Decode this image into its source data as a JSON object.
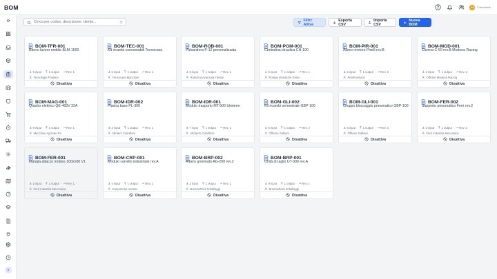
{
  "app": {
    "title": "BOM"
  },
  "header": {
    "user": {
      "initials": "AS",
      "name": "Cavia Andr..."
    }
  },
  "sidebar": {
    "avatar_initials": "T"
  },
  "search": {
    "placeholder": "Cerca per codice, descrizione, cliente..."
  },
  "toolbar": {
    "filter_label": "Filtri: Attive",
    "export_label": "Esporta CSV",
    "import_label": "Importa CSV",
    "new_label": "Nuova BOM"
  },
  "cards": [
    {
      "code": "BOM-TFR-001",
      "desc": "Banco lavoro mobile BLM-1500",
      "inputs": "5 input",
      "outputs": "1 output",
      "rev": "Rev. 1",
      "client": "Tecnologie Friulane",
      "action": "Disattiva"
    },
    {
      "code": "BOM-TEC-001",
      "desc": "Kit ricambi consumabili Tecnocasa",
      "inputs": "5 input",
      "outputs": "1 output",
      "rev": "Rev. 1",
      "client": "Tecnocasa Macchine",
      "action": "Disattiva"
    },
    {
      "code": "BOM-ROB-001",
      "desc": "Pulsantiera P-12 personalizzata",
      "inputs": "8 input",
      "outputs": "1 output",
      "rev": "Rev. 1",
      "client": "Robotica Avanzata Trieste",
      "action": "Disattiva"
    },
    {
      "code": "BOM-POM-001",
      "desc": "Centralina idraulica CH-100",
      "inputs": "9 input",
      "outputs": "1 output",
      "rev": "Rev. 1",
      "client": "Pompe Idrauliche Torino",
      "action": "Disattiva"
    },
    {
      "code": "BOM-PIR-001",
      "desc": "Albero motore Pirelli rev.B",
      "inputs": "2 input",
      "outputs": "1 output",
      "rev": "Rev. 2",
      "client": "Pirelli Service",
      "action": "Disattiva"
    },
    {
      "code": "BOM-MOD-001",
      "desc": "Carena C-50 rev.B Modena Racing",
      "inputs": "2 input",
      "outputs": "1 output",
      "rev": "Rev. 2",
      "client": "Officine Modena Racing",
      "action": "Disattiva"
    },
    {
      "code": "BOM-MAG-001",
      "desc": "Quadro elettrico QE-400V 32A",
      "inputs": "9 input",
      "outputs": "1 output",
      "rev": "Rev. 1",
      "client": "Macchine Agricole Po",
      "action": "Disattiva"
    },
    {
      "code": "BOM-IDR-002",
      "desc": "Piastra base PL-300",
      "inputs": "2 input",
      "outputs": "1 output",
      "rev": "Rev. 1",
      "client": "Idrotern Calorifero",
      "action": "Disattiva"
    },
    {
      "code": "BOM-IDR-001",
      "desc": "Modulo trasporto MT-500 Idroterm",
      "inputs": "7 input",
      "outputs": "1 output",
      "rev": "Rev. 1",
      "client": "Idroterm Calorifero",
      "action": "Disattiva"
    },
    {
      "code": "BOM-GLI-002",
      "desc": "Kit ricambi semestrale GBP-100",
      "inputs": "5 input",
      "outputs": "1 output",
      "rev": "Rev. 2",
      "client": "Officine Galliani",
      "action": "Disattiva"
    },
    {
      "code": "BOM-GLI-001",
      "desc": "Gruppo bloccaggio pneumatico GBP-100",
      "inputs": "6 input",
      "outputs": "1 output",
      "rev": "Rev. 3",
      "client": "Officine Galliani",
      "action": "Disattiva"
    },
    {
      "code": "BOM-FER-002",
      "desc": "Supporto pneumatico Ferri rev.2",
      "inputs": "3 input",
      "outputs": "1 output",
      "rev": "Rev. 2",
      "client": "Ferri Industria Meccanica",
      "action": "Disattiva"
    },
    {
      "code": "BOM-FER-001",
      "desc": "Flangia attacco motore 100x100 V1",
      "inputs": "2 input",
      "outputs": "1 output",
      "rev": "Rev. 1",
      "client": "Ferri Industria Meccanica",
      "action": "Disattiva"
    },
    {
      "code": "BOM-CRP-001",
      "desc": "Modulo carrello industriale rev.A",
      "inputs": "4 input",
      "outputs": "1 output",
      "rev": "Rev. 1",
      "client": "Carpenteria Veneta",
      "action": "Disattiva"
    },
    {
      "code": "BOM-BRP-002",
      "desc": "Albero gommato AG-200 rev.2",
      "inputs": "2 input",
      "outputs": "1 output",
      "rev": "Rev. 1",
      "client": "BresciaPack Imballaggi",
      "action": "Disattiva"
    },
    {
      "code": "BOM-BRP-001",
      "desc": "Unità di taglio UT-300 rev.A",
      "inputs": "9 input",
      "outputs": "1 output",
      "rev": "Rev. 1",
      "client": "BresciaPack Imballaggi",
      "action": "Disattiva"
    }
  ]
}
